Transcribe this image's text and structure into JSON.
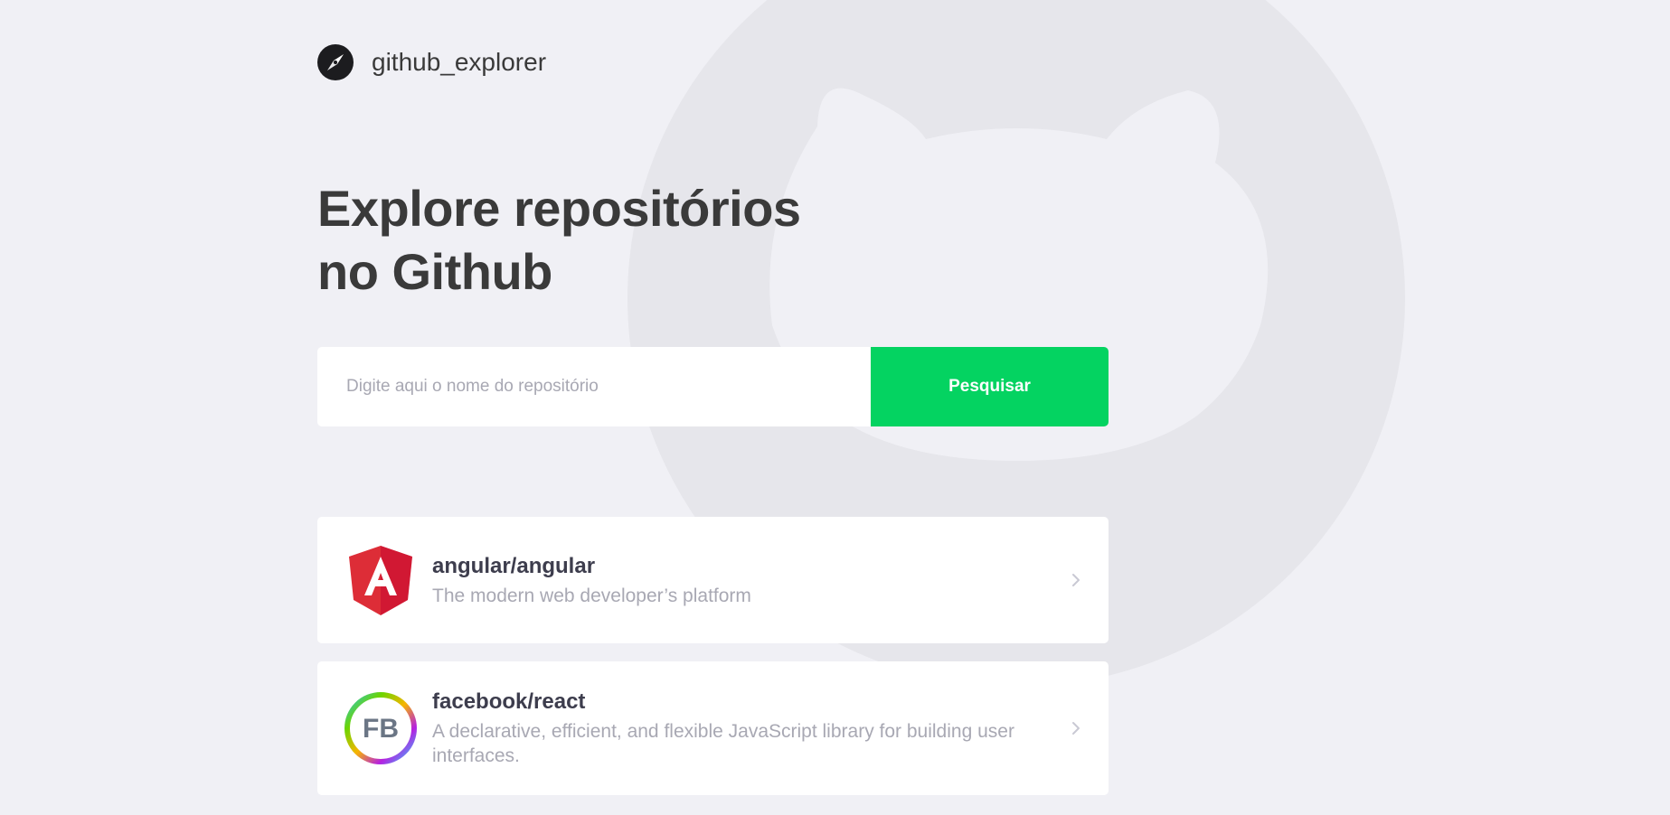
{
  "app": {
    "brand_name": "github_explorer"
  },
  "hero": {
    "title_line_1": "Explore repositórios",
    "title_line_2": "no Github"
  },
  "search": {
    "placeholder": "Digite aqui o nome do repositório",
    "button_label": "Pesquisar"
  },
  "repositories": [
    {
      "name": "angular/angular",
      "description": "The modern web developer’s platform",
      "avatar": "angular-logo-icon"
    },
    {
      "name": "facebook/react",
      "description": "A declarative, efficient, and flexible JavaScript library for building user interfaces.",
      "avatar_label": "FB",
      "avatar": "facebook-avatar-icon"
    }
  ],
  "colors": {
    "background": "#f0f0f5",
    "primary": "#04d361",
    "title": "#3a3a3a",
    "muted": "#a8a8b3",
    "card": "#ffffff"
  }
}
